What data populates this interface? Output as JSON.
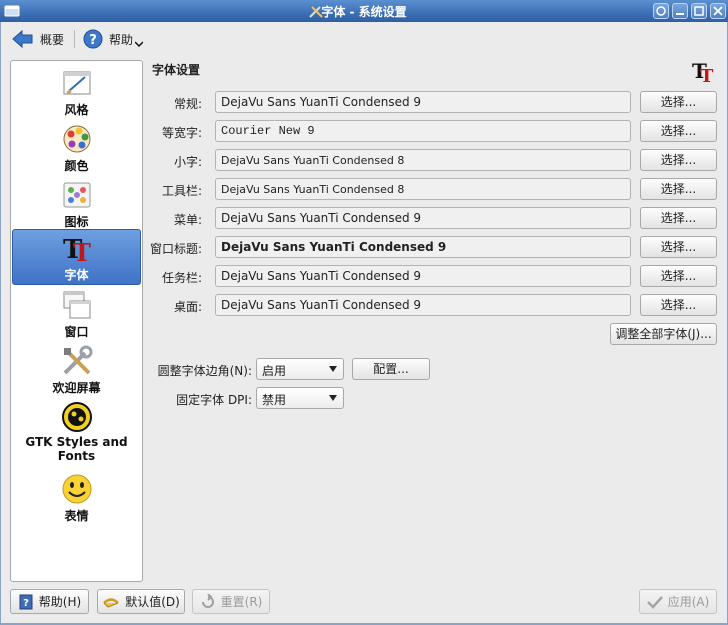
{
  "window": {
    "title": "字体 - 系统设置"
  },
  "toolbar": {
    "back_label": "概要",
    "help_label": "帮助"
  },
  "sidebar": {
    "items": [
      {
        "label": "风格",
        "icon": "style-icon"
      },
      {
        "label": "颜色",
        "icon": "colors-icon"
      },
      {
        "label": "图标",
        "icon": "icons-icon"
      },
      {
        "label": "字体",
        "icon": "fonts-icon",
        "selected": true
      },
      {
        "label": "窗口",
        "icon": "windows-icon"
      },
      {
        "label": "欢迎屏幕",
        "icon": "splash-screen-icon"
      },
      {
        "label": "GTK Styles and Fonts",
        "icon": "gtk-icon"
      },
      {
        "label": "表情",
        "icon": "emoticons-icon"
      }
    ]
  },
  "main": {
    "section_title": "字体设置",
    "choose_label": "选择...",
    "rows": [
      {
        "label": "常规:",
        "font": "DejaVu Sans YuanTi Condensed 9"
      },
      {
        "label": "等宽字:",
        "font": "Courier New 9"
      },
      {
        "label": "小字:",
        "font": "DejaVu Sans YuanTi Condensed 8"
      },
      {
        "label": "工具栏:",
        "font": "DejaVu Sans YuanTi Condensed 8"
      },
      {
        "label": "菜单:",
        "font": "DejaVu Sans YuanTi Condensed 9"
      },
      {
        "label": "窗口标题:",
        "font": "DejaVu Sans YuanTi Condensed 9"
      },
      {
        "label": "任务栏:",
        "font": "DejaVu Sans YuanTi Condensed 9"
      },
      {
        "label": "桌面:",
        "font": "DejaVu Sans YuanTi Condensed 9"
      }
    ],
    "adjust_all_label": "调整全部字体(J)...",
    "antialias": {
      "label": "圆整字体边角(N):",
      "value": "启用",
      "configure_label": "配置..."
    },
    "force_dpi": {
      "label": "固定字体 DPI:",
      "value": "禁用"
    }
  },
  "bottom": {
    "help_label": "帮助(H)",
    "defaults_label": "默认值(D)",
    "reset_label": "重置(R)",
    "apply_label": "应用(A)"
  },
  "colors": {
    "titlebar": "#3c6fb5",
    "selection": "#4a7fcf"
  }
}
